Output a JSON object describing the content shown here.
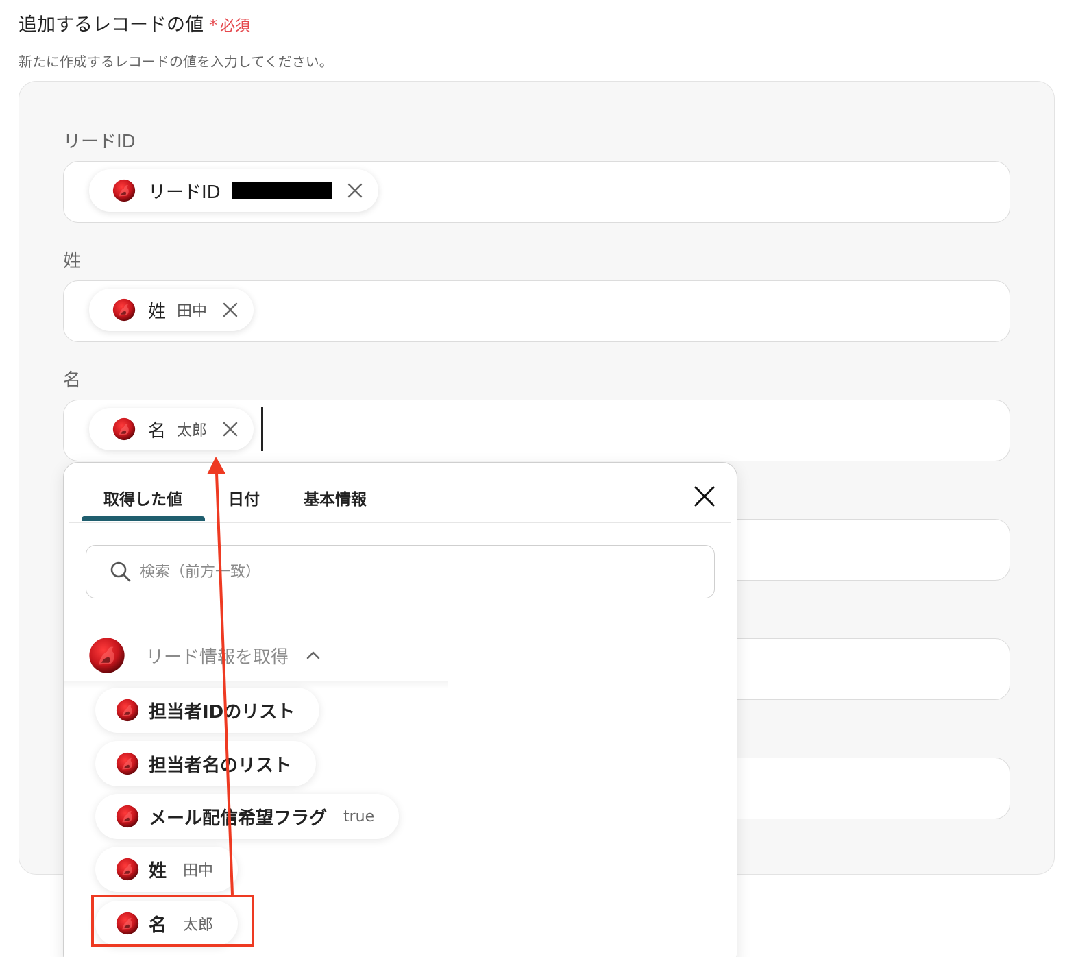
{
  "header": {
    "title": "追加するレコードの値",
    "required_mark": "*",
    "required_text": "必須",
    "description": "新たに作成するレコードの値を入力してください。"
  },
  "fields": [
    {
      "label": "リードID",
      "chip_label": "リードID",
      "chip_value": ""
    },
    {
      "label": "姓",
      "chip_label": "姓",
      "chip_value": "田中"
    },
    {
      "label": "名",
      "chip_label": "名",
      "chip_value": "太郎"
    }
  ],
  "dropdown": {
    "tabs": [
      {
        "label": "取得した値",
        "active": true
      },
      {
        "label": "日付",
        "active": false
      },
      {
        "label": "基本情報",
        "active": false
      }
    ],
    "search_placeholder": "検索（前方一致）",
    "group_label": "リード情報を取得",
    "options": [
      {
        "label": "担当者IDのリスト",
        "value": ""
      },
      {
        "label": "担当者名のリスト",
        "value": ""
      },
      {
        "label": "メール配信希望フラグ",
        "value": "true"
      },
      {
        "label": "姓",
        "value": "田中"
      },
      {
        "label": "名",
        "value": "太郎"
      }
    ]
  },
  "colors": {
    "required": "#e5484d",
    "tab_indicator": "#1f5e6e",
    "annotation": "#ee3a22",
    "app_icon": "#c8161d"
  },
  "icons": [
    "app-icon",
    "close-icon",
    "search-icon",
    "chevron-up-icon"
  ]
}
